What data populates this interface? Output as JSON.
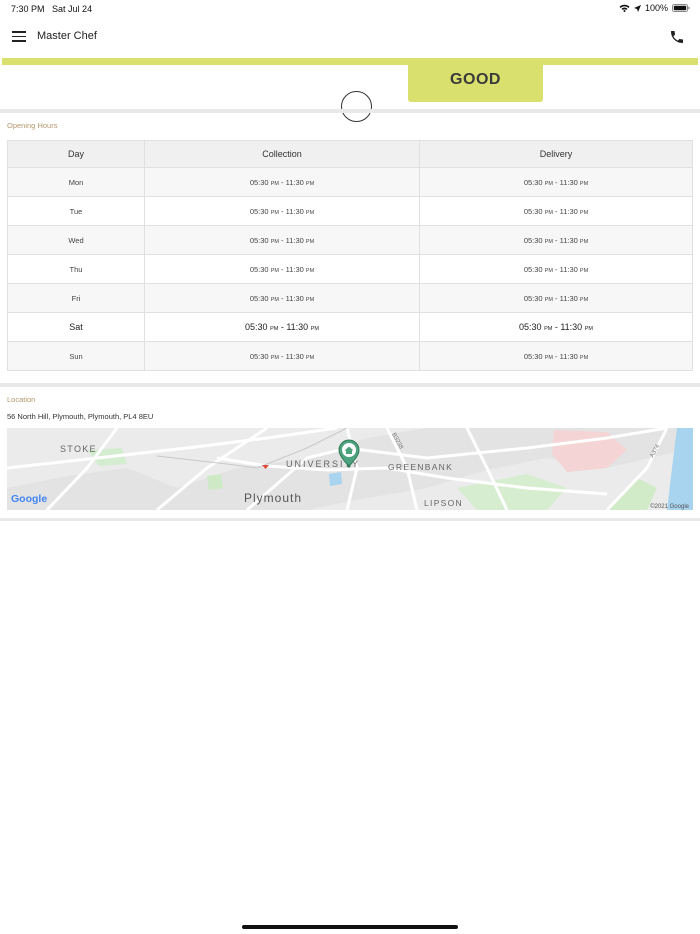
{
  "status_bar": {
    "time": "7:30 PM",
    "date": "Sat Jul 24",
    "battery": "100%",
    "icons": [
      "wifi-icon",
      "location-arrow-icon",
      "battery-icon"
    ]
  },
  "header": {
    "title": "Master Chef",
    "menu_icon": "hamburger-menu-icon",
    "phone_icon": "phone-icon"
  },
  "rating": {
    "label": "GOOD",
    "color": "#d9e06d"
  },
  "opening_hours": {
    "section_label": "Opening Hours",
    "columns": [
      "Day",
      "Collection",
      "Delivery"
    ],
    "rows": [
      {
        "day": "Mon",
        "collection_start": "05:30",
        "collection_end": "11:30",
        "delivery_start": "05:30",
        "delivery_end": "11:30",
        "suffix": "PM"
      },
      {
        "day": "Tue",
        "collection_start": "05:30",
        "collection_end": "11:30",
        "delivery_start": "05:30",
        "delivery_end": "11:30",
        "suffix": "PM"
      },
      {
        "day": "Wed",
        "collection_start": "05:30",
        "collection_end": "11:30",
        "delivery_start": "05:30",
        "delivery_end": "11:30",
        "suffix": "PM"
      },
      {
        "day": "Thu",
        "collection_start": "05:30",
        "collection_end": "11:30",
        "delivery_start": "05:30",
        "delivery_end": "11:30",
        "suffix": "PM"
      },
      {
        "day": "Fri",
        "collection_start": "05:30",
        "collection_end": "11:30",
        "delivery_start": "05:30",
        "delivery_end": "11:30",
        "suffix": "PM"
      },
      {
        "day": "Sat",
        "collection_start": "05:30",
        "collection_end": "11:30",
        "delivery_start": "05:30",
        "delivery_end": "11:30",
        "suffix": "PM"
      },
      {
        "day": "Sun",
        "collection_start": "05:30",
        "collection_end": "11:30",
        "delivery_start": "05:30",
        "delivery_end": "11:30",
        "suffix": "PM"
      }
    ],
    "highlighted_day": "Sat"
  },
  "location": {
    "section_label": "Location",
    "address": "56 North Hill, Plymouth, Plymouth, PL4 8EU",
    "map": {
      "labels": {
        "stoke": "STOKE",
        "university": "UNIVERSITY",
        "greenbank": "GREENBANK",
        "plymouth": "Plymouth",
        "lipson": "LIPSON",
        "road_b3238": "B3238",
        "road_a374": "A374"
      },
      "attribution": "©2021 Google",
      "logo": "Google",
      "marker_icon": "home-marker-icon"
    }
  }
}
